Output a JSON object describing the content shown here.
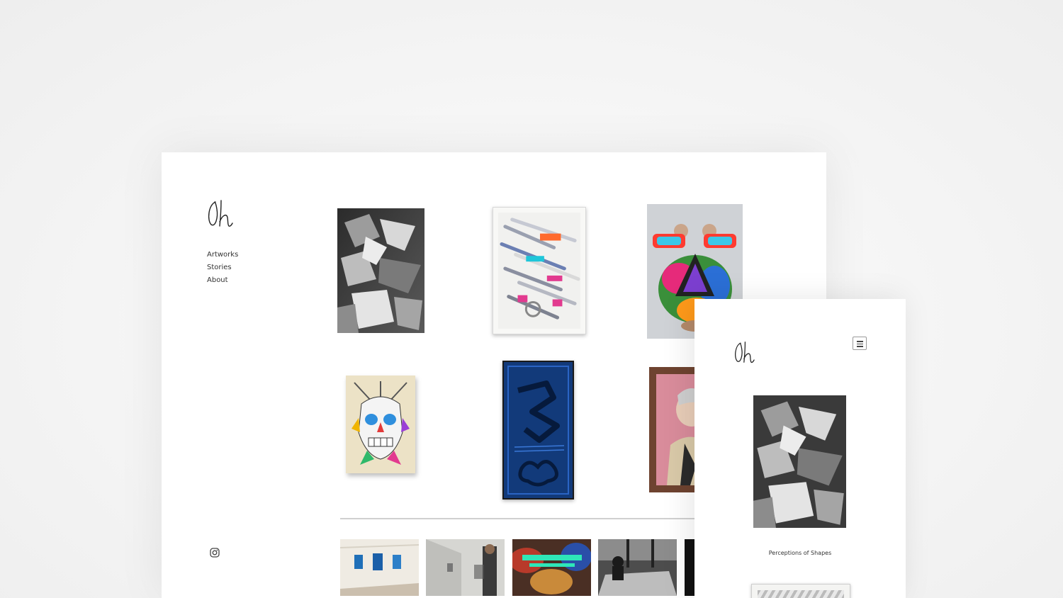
{
  "logo_text": "Oh",
  "nav": [
    {
      "label": "Artworks"
    },
    {
      "label": "Stories"
    },
    {
      "label": "About"
    }
  ],
  "social": {
    "icon": "instagram-icon"
  },
  "mobile": {
    "menu_icon": "hamburger-menu-icon",
    "caption": "Perceptions of Shapes"
  },
  "colors": {
    "background": "#ffffff",
    "text": "#333333",
    "divider": "#d0d0d0"
  }
}
